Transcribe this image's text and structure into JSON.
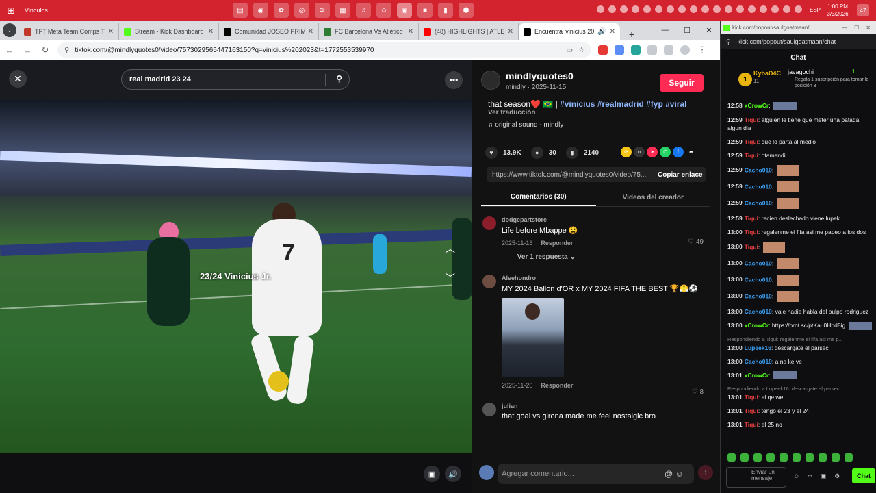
{
  "taskbar": {
    "label": "Vinculos",
    "apps": [
      "files",
      "chrome",
      "photos",
      "steam",
      "spotify",
      "calendar",
      "sound",
      "discord",
      "chrome-profile",
      "red-app",
      "green-app",
      "shield"
    ],
    "lang": "ESP",
    "time": "1:00 PM",
    "date": "3/3/2026",
    "notif": "47"
  },
  "browser": {
    "tabs": [
      {
        "title": "TFT Meta Team Comps Tier",
        "color": "#c0392b"
      },
      {
        "title": "Stream - Kick Dashboard",
        "color": "#53fc18"
      },
      {
        "title": "Comunidad JOSEO PRIME",
        "color": "#000000"
      },
      {
        "title": "FC Barcelona Vs Atlético de",
        "color": "#2e7d32"
      },
      {
        "title": "(48) HIGHLIGHTS | ATLETIC",
        "color": "#ff0000"
      },
      {
        "title": "Encuentra 'vinicius 2023",
        "color": "#000000"
      }
    ],
    "url": "tiktok.com/@mindlyquotes0/video/7573029565447163150?q=vinicius%202023&t=1772553539970"
  },
  "video": {
    "search": "real madrid 23 24",
    "overlay_text": "23/24 Vinicius Jr.",
    "jersey_number": "7"
  },
  "post": {
    "author": "mindlyquotes0",
    "sub": "mindly · 2025-11-15",
    "follow": "Seguir",
    "desc_prefix": "that season❤️ 🇧🇷 |",
    "tags": "#vinicius #realmadrid #fyp #viral",
    "translate": "Ver traducción",
    "sound": "original sound - mindly",
    "likes": "13.9K",
    "comments": "30",
    "saves": "2140",
    "link": "https://www.tiktok.com/@mindlyquotes0/video/75...",
    "copy": "Copiar enlace",
    "tab_comments": "Comentarios (30)",
    "tab_creator": "Videos del creador"
  },
  "comments": [
    {
      "user": "dodgepartstore",
      "text": "Life before Mbappe 😩",
      "date": "2025-11-16",
      "reply": "Responder",
      "likes": "49",
      "replies": "Ver 1 respuesta"
    },
    {
      "user": "Aleehondro",
      "text": "MY 2024 Ballon d'OR x MY 2024 FIFA THE BEST 🏆😤⚽",
      "date": "2025-11-20",
      "reply": "Responder",
      "likes": "8"
    },
    {
      "user": "julian",
      "text": "that goal vs girona made me feel nostalgic bro"
    }
  ],
  "add_comment": "Agregar comentario...",
  "kick": {
    "title": "kick.com/popout/saulgoatmaan/...",
    "url": "kick.com/popout/saulgoatmaan/chat",
    "chat_label": "Chat",
    "gift_user": "KybaD4C",
    "gift_count": "11",
    "gift_rank": "1",
    "gift_to": "javagochi",
    "gift_x": "1",
    "gift_desc": "Regala 1 suscripción para tomar la posición 3",
    "messages": [
      {
        "t": "12:58",
        "u": "xCrowCr",
        "c": "#53fc18",
        "m": "",
        "emote": true
      },
      {
        "t": "12:59",
        "u": "Tiqui",
        "c": "#e23d3d",
        "m": "alguien le tiene que meter una patada algun dia"
      },
      {
        "t": "12:59",
        "u": "Tiqui",
        "c": "#e23d3d",
        "m": "que lo parta al medio"
      },
      {
        "t": "12:59",
        "u": "Tiqui",
        "c": "#e23d3d",
        "m": "otamendi"
      },
      {
        "t": "12:59",
        "u": "Cacho010",
        "c": "#3aa0f5",
        "m": "",
        "face": true
      },
      {
        "t": "12:59",
        "u": "Cacho010",
        "c": "#3aa0f5",
        "m": "",
        "face": true
      },
      {
        "t": "12:59",
        "u": "Cacho010",
        "c": "#3aa0f5",
        "m": "",
        "face": true
      },
      {
        "t": "12:59",
        "u": "Tiqui",
        "c": "#e23d3d",
        "m": "recien deslechado viene lupek"
      },
      {
        "t": "13:00",
        "u": "Tiqui",
        "c": "#e23d3d",
        "m": "regalenme el fifa asi me papeo a los dos"
      },
      {
        "t": "13:00",
        "u": "Tiqui",
        "c": "#e23d3d",
        "m": "",
        "face": true
      },
      {
        "t": "13:00",
        "u": "Cacho010",
        "c": "#3aa0f5",
        "m": "",
        "face": true
      },
      {
        "t": "13:00",
        "u": "Cacho010",
        "c": "#3aa0f5",
        "m": "",
        "face": true
      },
      {
        "t": "13:00",
        "u": "Cacho010",
        "c": "#3aa0f5",
        "m": "",
        "face": true
      },
      {
        "t": "13:00",
        "u": "Cacho010",
        "c": "#3aa0f5",
        "m": "vale nadie habla del pulpo rodriguez"
      },
      {
        "t": "13:00",
        "u": "xCrowCr",
        "c": "#53fc18",
        "m": "https://prnt.sc/ptKau0Hbd8ig",
        "emote": true
      },
      {
        "t": "13:00",
        "u": "Lupeek16",
        "c": "#3aa0f5",
        "m": "descargate el parsec",
        "replyTo": "Respondiendo a Tiqui: regalenme el fifa asi me p..."
      },
      {
        "t": "13:00",
        "u": "Cacho010",
        "c": "#3aa0f5",
        "m": "a na ke ve"
      },
      {
        "t": "13:01",
        "u": "xCrowCr",
        "c": "#53fc18",
        "m": "",
        "emote": true
      },
      {
        "t": "13:01",
        "u": "Tiqui",
        "c": "#e23d3d",
        "m": "el qe we",
        "replyTo": "Respondiendo a Lupeek16: descargate el parsec ..."
      },
      {
        "t": "13:01",
        "u": "Tiqui",
        "c": "#e23d3d",
        "m": "tengo el 23 y el 24"
      },
      {
        "t": "13:01",
        "u": "Tiqui",
        "c": "#e23d3d",
        "m": "el 25 no"
      }
    ],
    "input_placeholder": "Enviar un mensaje",
    "send": "Chat"
  }
}
